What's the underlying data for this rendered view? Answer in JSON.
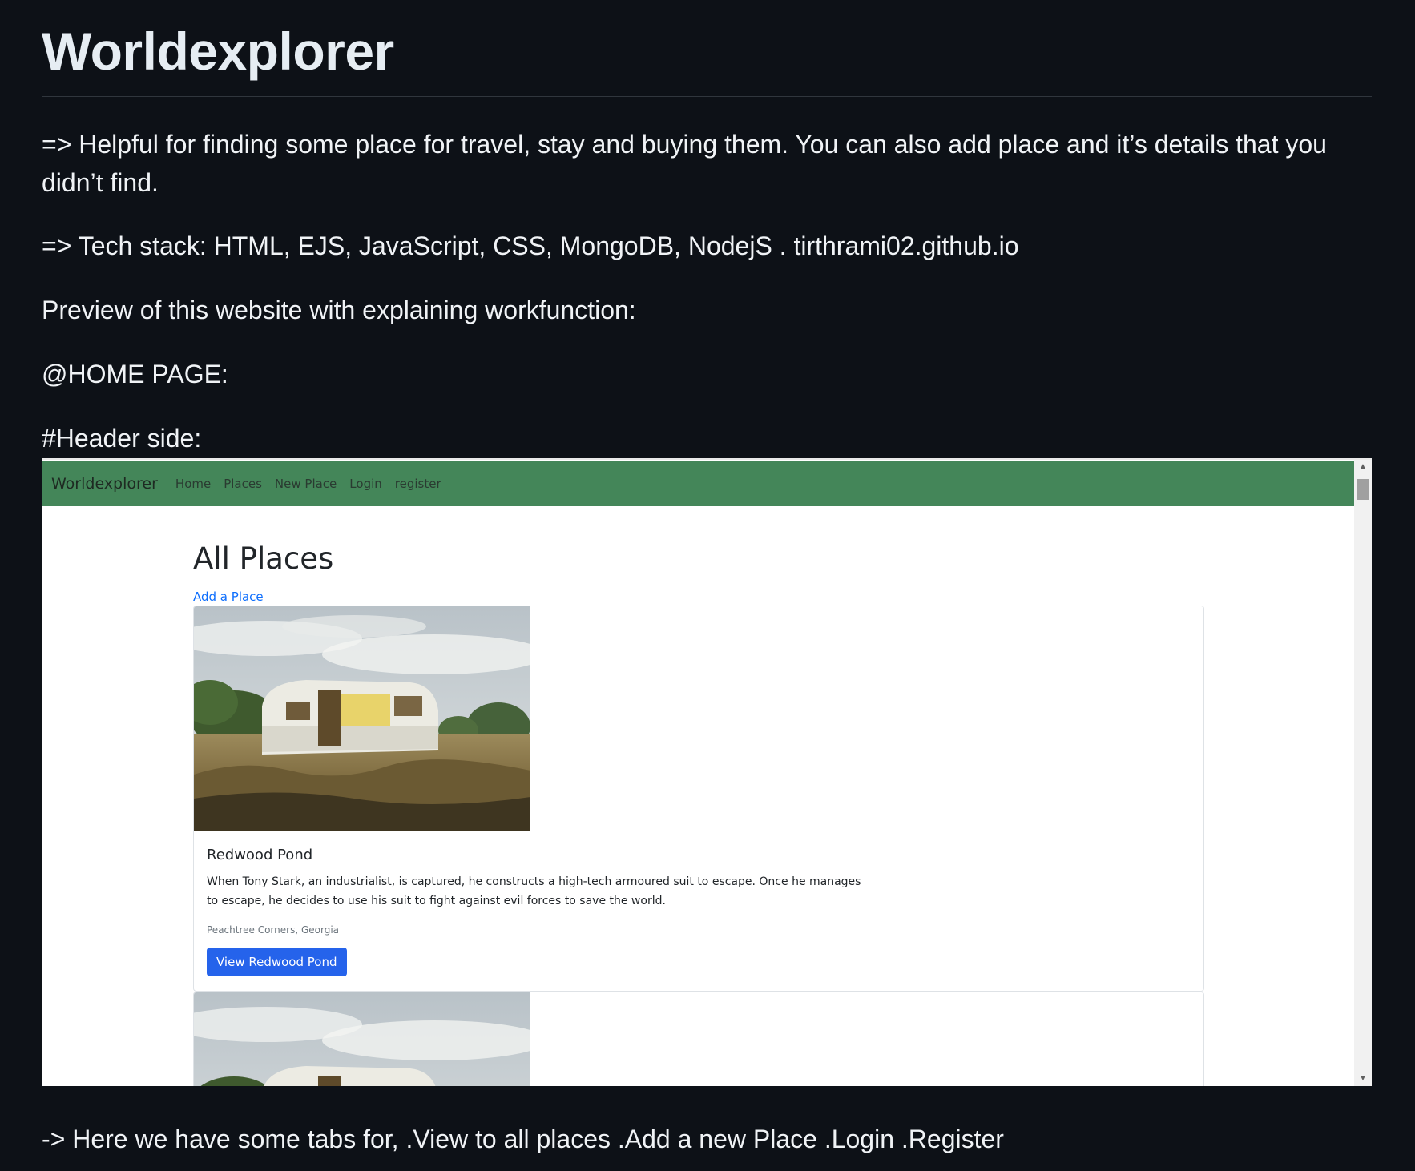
{
  "readme": {
    "title": "Worldexplorer",
    "description": "=> Helpful for finding some place for travel, stay and buying them. You can also add place and it’s details that you didn’t find.",
    "tech_stack": "=> Tech stack: HTML, EJS, JavaScript, CSS, MongoDB, NodejS . tirthrami02.github.io",
    "preview_intro": "Preview of this website with explaining workfunction:",
    "home_heading": "@HOME PAGE:",
    "header_heading": "#Header side:",
    "tabs_note": "-> Here we have some tabs for, .View to all places .Add a new Place .Login .Register"
  },
  "screenshot": {
    "nav": {
      "brand": "Worldexplorer",
      "links": [
        "Home",
        "Places",
        "New Place",
        "Login",
        "register"
      ],
      "color": "#448659"
    },
    "page_title": "All Places",
    "add_link": "Add a Place",
    "cards": [
      {
        "title": "Redwood Pond",
        "text": "When Tony Stark, an industrialist, is captured, he constructs a high-tech armoured suit to escape. Once he manages to escape, he decides to use his suit to fight against evil forces to save the world.",
        "location": "Peachtree Corners, Georgia",
        "button": "View Redwood Pond"
      }
    ],
    "button_color": "#2563eb"
  }
}
